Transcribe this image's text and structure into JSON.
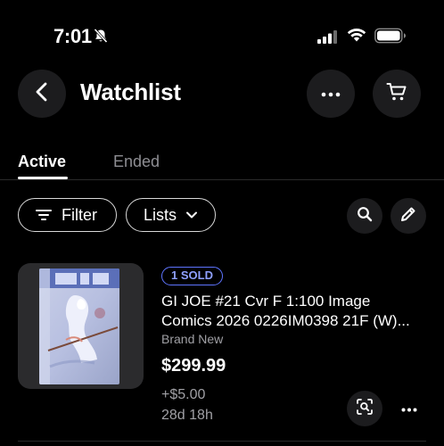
{
  "status_bar": {
    "time": "7:01",
    "icons": [
      "bell-slash-icon",
      "cellular-signal-icon",
      "wifi-icon",
      "battery-icon"
    ]
  },
  "header": {
    "title": "Watchlist",
    "icons": [
      "chevron-left-icon",
      "more-horizontal-icon",
      "cart-icon"
    ]
  },
  "tabs": [
    {
      "label": "Active",
      "selected": true
    },
    {
      "label": "Ended",
      "selected": false
    }
  ],
  "toolbar": {
    "filter_label": "Filter",
    "lists_label": "Lists",
    "icons": [
      "filter-icon",
      "chevron-down-icon",
      "search-icon",
      "pencil-icon"
    ]
  },
  "items": [
    {
      "badge": "1 SOLD",
      "title_line1": "GI JOE #21 Cvr F 1:100 Image",
      "title_line2": "Comics 2026 0226IM0398 21F (W)...",
      "condition": "Brand New",
      "price": "$299.99",
      "shipping": "+$5.00",
      "time_left": "28d 18h",
      "icons": [
        "visual-search-icon",
        "more-horizontal-icon"
      ]
    }
  ],
  "colors": {
    "background": "#000000",
    "surface": "#1c1c1e",
    "secondary_text": "#a0a0a5",
    "badge_accent": "#5e74ff"
  }
}
